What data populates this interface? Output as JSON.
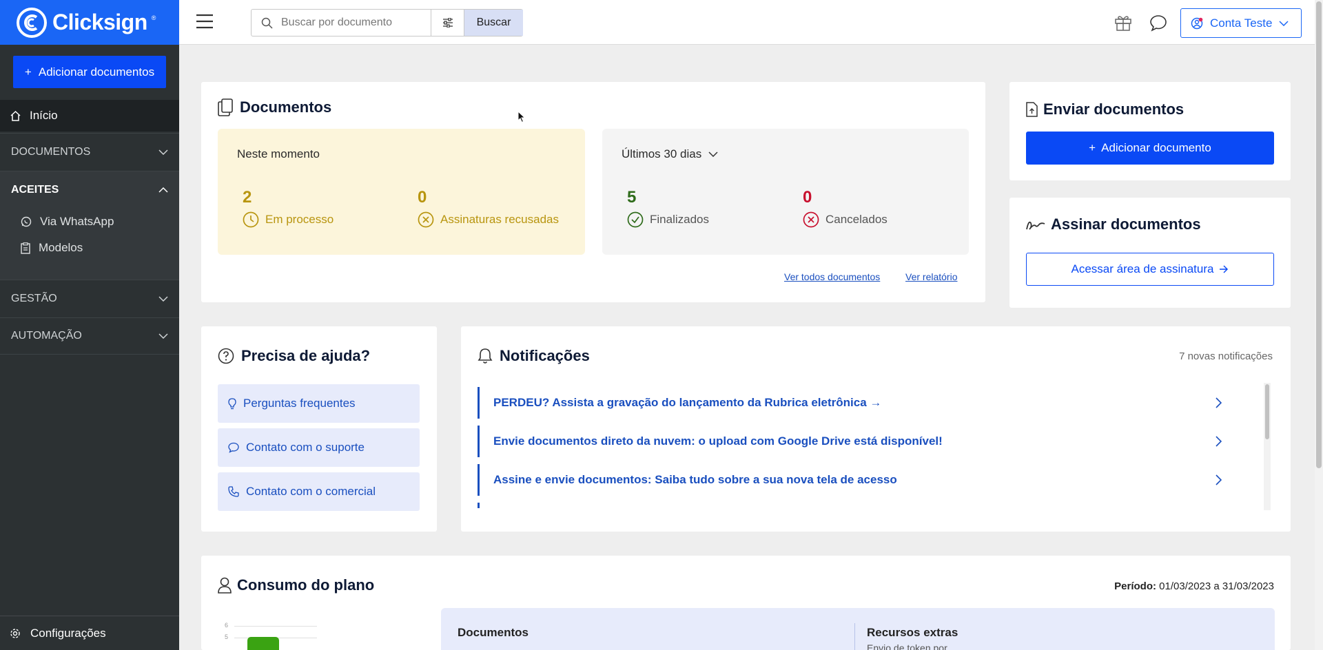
{
  "brand": {
    "name": "Clicksign",
    "reg": "®"
  },
  "sidebar": {
    "add_button": "Adicionar documentos",
    "home": "Início",
    "sections": [
      {
        "label": "DOCUMENTOS",
        "open": false
      },
      {
        "label": "ACEITES",
        "open": true
      },
      {
        "label": "GESTÃO",
        "open": false
      },
      {
        "label": "AUTOMAÇÃO",
        "open": false
      }
    ],
    "aceites_items": [
      {
        "label": "Via WhatsApp",
        "icon": "whatsapp-icon"
      },
      {
        "label": "Modelos",
        "icon": "clipboard-icon"
      }
    ],
    "settings": "Configurações"
  },
  "topbar": {
    "search_placeholder": "Buscar por documento",
    "search_value": "",
    "search_button": "Buscar",
    "account": "Conta Teste"
  },
  "documents": {
    "title": "Documentos",
    "now": {
      "label": "Neste momento",
      "in_process": {
        "count": "2",
        "label": "Em processo"
      },
      "refused": {
        "count": "0",
        "label": "Assinaturas recusadas"
      }
    },
    "period": {
      "label": "Últimos 30 dias",
      "finished": {
        "count": "5",
        "label": "Finalizados"
      },
      "canceled": {
        "count": "0",
        "label": "Cancelados"
      }
    },
    "link_all": "Ver todos documentos",
    "link_report": "Ver relatório"
  },
  "send": {
    "title": "Enviar documentos",
    "button": "Adicionar documento"
  },
  "sign": {
    "title": "Assinar documentos",
    "button": "Acessar área de assinatura"
  },
  "help": {
    "title": "Precisa de ajuda?",
    "items": [
      {
        "label": "Perguntas frequentes",
        "icon": "lightbulb-icon"
      },
      {
        "label": "Contato com o suporte",
        "icon": "chat-icon"
      },
      {
        "label": "Contato com o comercial",
        "icon": "phone-icon"
      }
    ]
  },
  "notifications": {
    "title": "Notificações",
    "count_text": "7 novas notificações",
    "items": [
      "PERDEU? Assista a gravação do lançamento da Rubrica eletrônica →",
      "Envie documentos direto da nuvem: o upload com Google Drive está disponível!",
      "Assine e envie documentos: Saiba tudo sobre a sua nova tela de acesso"
    ]
  },
  "plan": {
    "title": "Consumo do plano",
    "period_label": "Período:",
    "period_value": "01/03/2023 a 31/03/2023",
    "col1": "Documentos",
    "col2": "Recursos extras",
    "col2_sub": "Envio de token por",
    "chart_ticks": [
      "6",
      "5"
    ]
  },
  "colors": {
    "brand_blue": "#1a66f5",
    "button_blue": "#0a49f5",
    "sidebar_bg": "#2c3133",
    "amber": "#b8950f",
    "green": "#2e6b1a",
    "red": "#c8102e",
    "link": "#1a4fbf"
  }
}
